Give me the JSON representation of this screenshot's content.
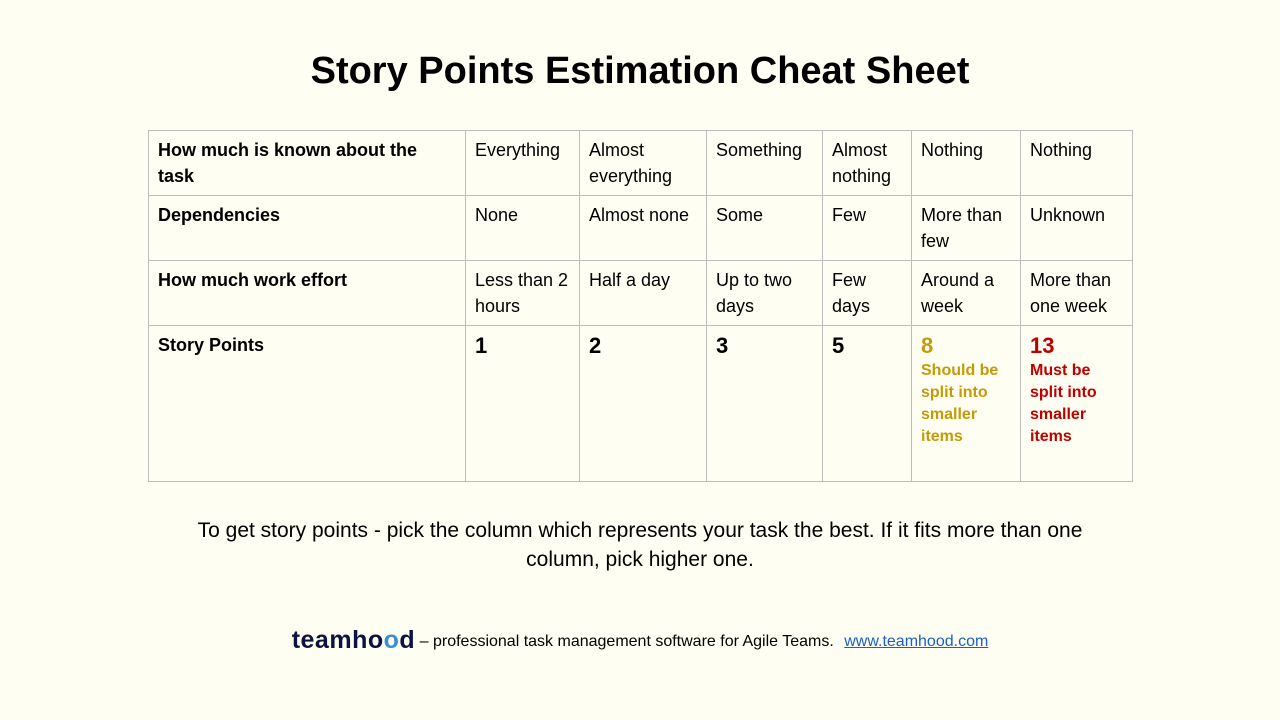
{
  "title": "Story Points Estimation Cheat Sheet",
  "colors": {
    "background": "#fefef2",
    "warning": "#c49a0a",
    "danger": "#c00000",
    "link": "#1a5fc9"
  },
  "table": {
    "rows": [
      {
        "label": "How much is known about the task",
        "cells": [
          "Everything",
          "Almost everything",
          "Something",
          "Almost nothing",
          "Nothing",
          "Nothing"
        ]
      },
      {
        "label": "Dependencies",
        "cells": [
          "None",
          "Almost none",
          "Some",
          "Few",
          "More than few",
          "Unknown"
        ]
      },
      {
        "label": "How much work effort",
        "cells": [
          "Less than 2 hours",
          "Half a day",
          "Up to two days",
          "Few days",
          "Around a week",
          "More than one week"
        ]
      }
    ],
    "story_points": {
      "label": "Story Points",
      "values": [
        "1",
        "2",
        "3",
        "5",
        "8",
        "13"
      ],
      "notes": {
        "8": "Should be split into smaller items",
        "13": "Must be split into smaller items"
      }
    }
  },
  "footnote": "To get story points - pick the column which represents your task the best. If it fits more than one column, pick higher one.",
  "footer": {
    "logo": "teamhood",
    "tagline": "– professional task management software for Agile Teams.",
    "link": "www.teamhood.com"
  }
}
